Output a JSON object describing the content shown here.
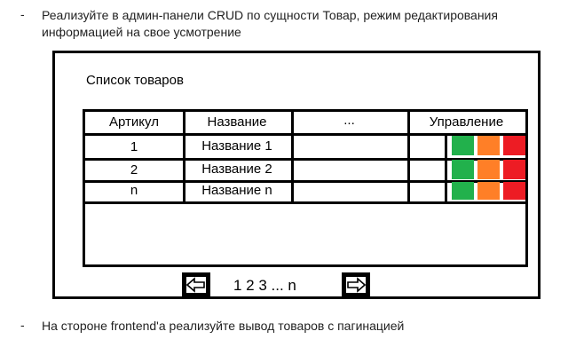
{
  "intro": {
    "bullet": "-",
    "text": "Реализуйте в админ-панели CRUD по сущности Товар, режим редактирования информацией на свое усмотрение"
  },
  "mockup": {
    "title": "Список товаров",
    "columns": [
      "Артикул",
      "Название",
      "...",
      "Управление"
    ],
    "rows": [
      {
        "sku": "1",
        "name": "Название 1"
      },
      {
        "sku": "2",
        "name": "Название 2"
      },
      {
        "sku": "n",
        "name": "Название n"
      }
    ],
    "action_colors": [
      "#22b14c",
      "#ff7f27",
      "#ed1c24"
    ],
    "pagination": {
      "prev_icon": "arrow-left-icon",
      "pages": "1 2 3 ... n",
      "next_icon": "arrow-right-icon"
    }
  },
  "footer": {
    "bullet": "-",
    "text": "На стороне frontend'а реализуйте вывод товаров с пагинацией"
  }
}
